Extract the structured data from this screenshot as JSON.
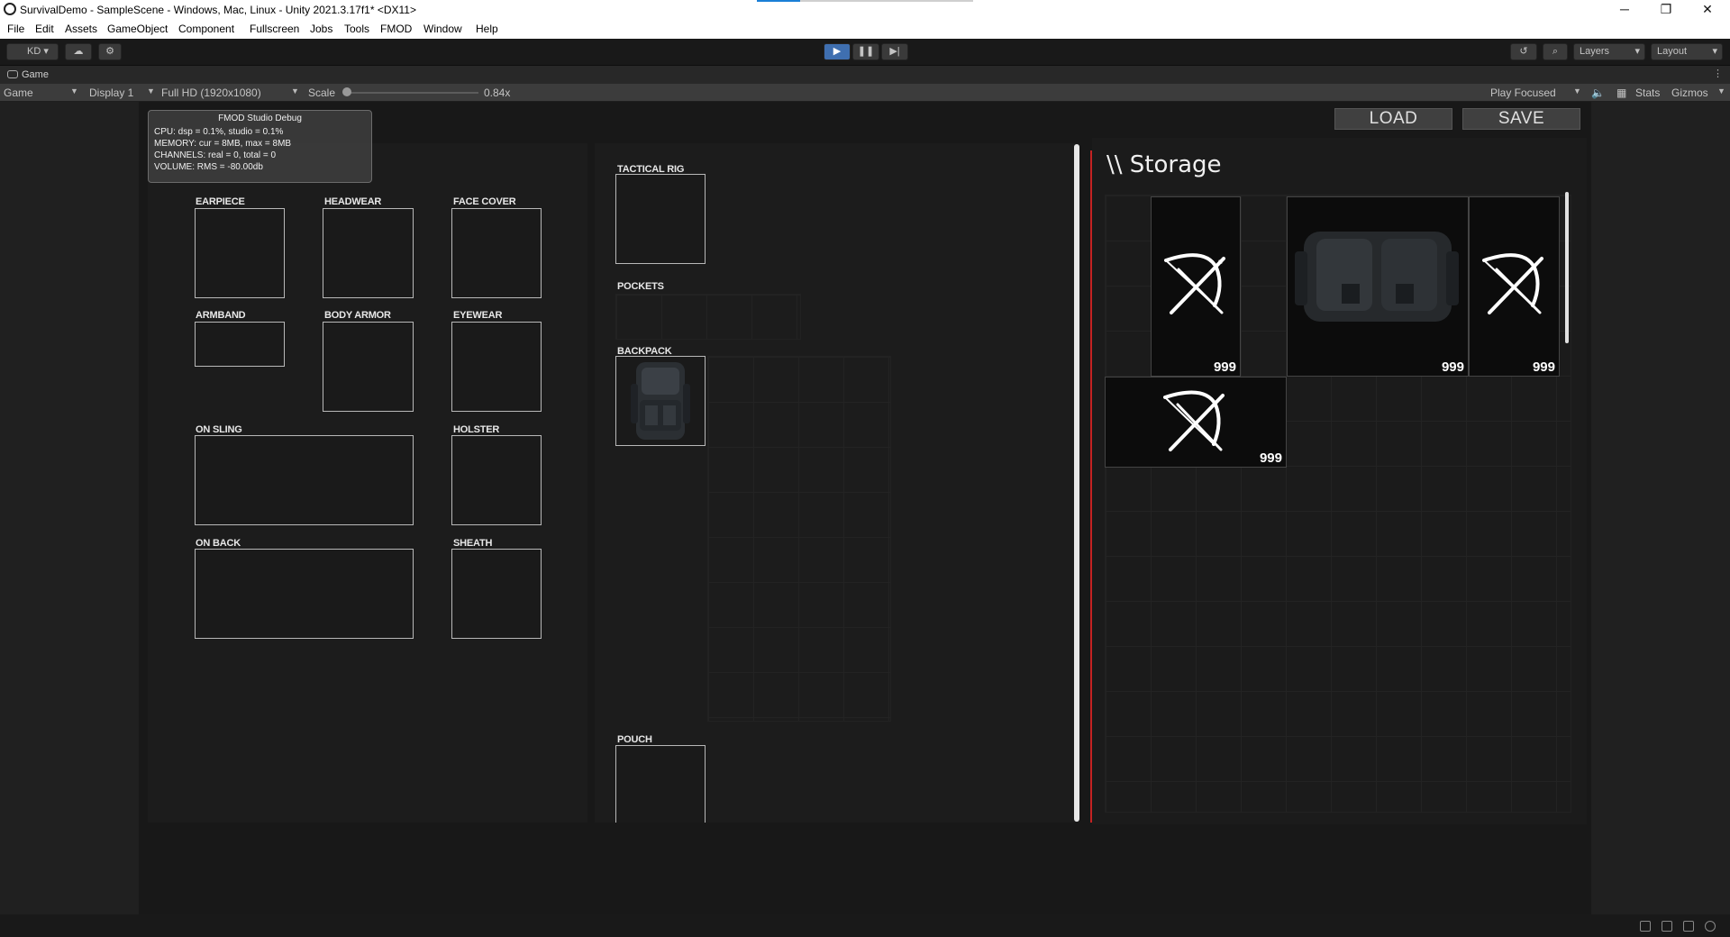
{
  "window": {
    "title": "SurvivalDemo - SampleScene - Windows, Mac, Linux - Unity 2021.3.17f1* <DX11>",
    "minimize": "─",
    "restore": "❐",
    "close": "✕"
  },
  "menu": [
    "File",
    "Edit",
    "Assets",
    "GameObject",
    "Component",
    "Fullscreen",
    "Jobs",
    "Tools",
    "FMOD",
    "Window",
    "Help"
  ],
  "toolbar": {
    "account": "KD",
    "layers": "Layers",
    "layout": "Layout"
  },
  "game_tab": {
    "label": "Game"
  },
  "game_bar": {
    "view": "Game",
    "display": "Display 1",
    "resolution": "Full HD (1920x1080)",
    "scale_label": "Scale",
    "scale_value": "0.84x",
    "play_mode": "Play Focused",
    "stats": "Stats",
    "gizmos": "Gizmos"
  },
  "fmod_debug": {
    "title": "FMOD Studio Debug",
    "cpu": "CPU: dsp = 0.1%, studio = 0.1%",
    "memory": "MEMORY: cur = 8MB, max = 8MB",
    "channels": "CHANNELS: real = 0, total = 0",
    "volume": "VOLUME: RMS = -80.00db"
  },
  "buttons": {
    "load": "LOAD",
    "save": "SAVE"
  },
  "equipment": {
    "earpiece": "EARPIECE",
    "headwear": "HEADWEAR",
    "face_cover": "FACE COVER",
    "armband": "ARMBAND",
    "body_armor": "BODY ARMOR",
    "eyewear": "EYEWEAR",
    "on_sling": "ON SLING",
    "holster": "HOLSTER",
    "on_back": "ON BACK",
    "sheath": "SHEATH"
  },
  "containers": {
    "tactical_rig": "TACTICAL RIG",
    "pockets": "POCKETS",
    "backpack": "BACKPACK",
    "pouch": "POUCH"
  },
  "storage": {
    "title": "\\\\ Storage",
    "items": [
      {
        "icon": "bow-arrows-icon",
        "qty": "999"
      },
      {
        "icon": "backpack-icon",
        "qty": "999"
      },
      {
        "icon": "bow-arrows-icon",
        "qty": "999"
      },
      {
        "icon": "bow-arrows-icon",
        "qty": "999"
      }
    ]
  }
}
